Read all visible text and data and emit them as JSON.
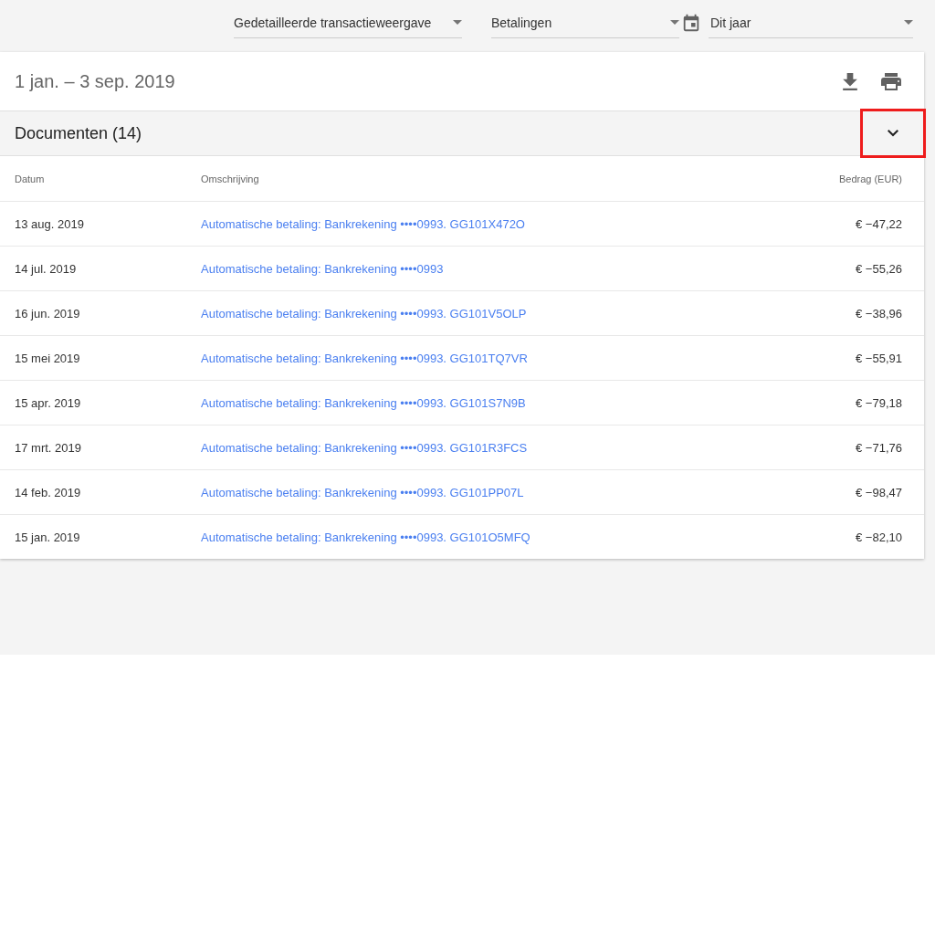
{
  "filters": [
    {
      "kind": "select",
      "label": "Gedetailleerde transactieweergave"
    },
    {
      "kind": "select",
      "label": "Betalingen"
    },
    {
      "kind": "date",
      "label": "Dit jaar"
    }
  ],
  "card": {
    "period": "1 jan. – 3 sep. 2019",
    "section": {
      "title": "Documenten (14)",
      "expanded": true,
      "highlighted": true
    },
    "table": {
      "columns": [
        "Datum",
        "Omschrijving",
        "Bedrag (EUR)"
      ],
      "rows": [
        {
          "date": "13 aug. 2019",
          "description": "Automatische betaling: Bankrekening ••••0993. GG101X472O",
          "amount": "€ −47,22"
        },
        {
          "date": "14 jul. 2019",
          "description": "Automatische betaling: Bankrekening ••••0993",
          "amount": "€ −55,26"
        },
        {
          "date": "16 jun. 2019",
          "description": "Automatische betaling: Bankrekening ••••0993. GG101V5OLP",
          "amount": "€ −38,96"
        },
        {
          "date": "15 mei 2019",
          "description": "Automatische betaling: Bankrekening ••••0993. GG101TQ7VR",
          "amount": "€ −55,91"
        },
        {
          "date": "15 apr. 2019",
          "description": "Automatische betaling: Bankrekening ••••0993. GG101S7N9B",
          "amount": "€ −79,18"
        },
        {
          "date": "17 mrt. 2019",
          "description": "Automatische betaling: Bankrekening ••••0993. GG101R3FCS",
          "amount": "€ −71,76"
        },
        {
          "date": "14 feb. 2019",
          "description": "Automatische betaling: Bankrekening ••••0993. GG101PP07L",
          "amount": "€ −98,47"
        },
        {
          "date": "15 jan. 2019",
          "description": "Automatische betaling: Bankrekening ••••0993. GG101O5MFQ",
          "amount": "€ −82,10"
        }
      ]
    }
  }
}
